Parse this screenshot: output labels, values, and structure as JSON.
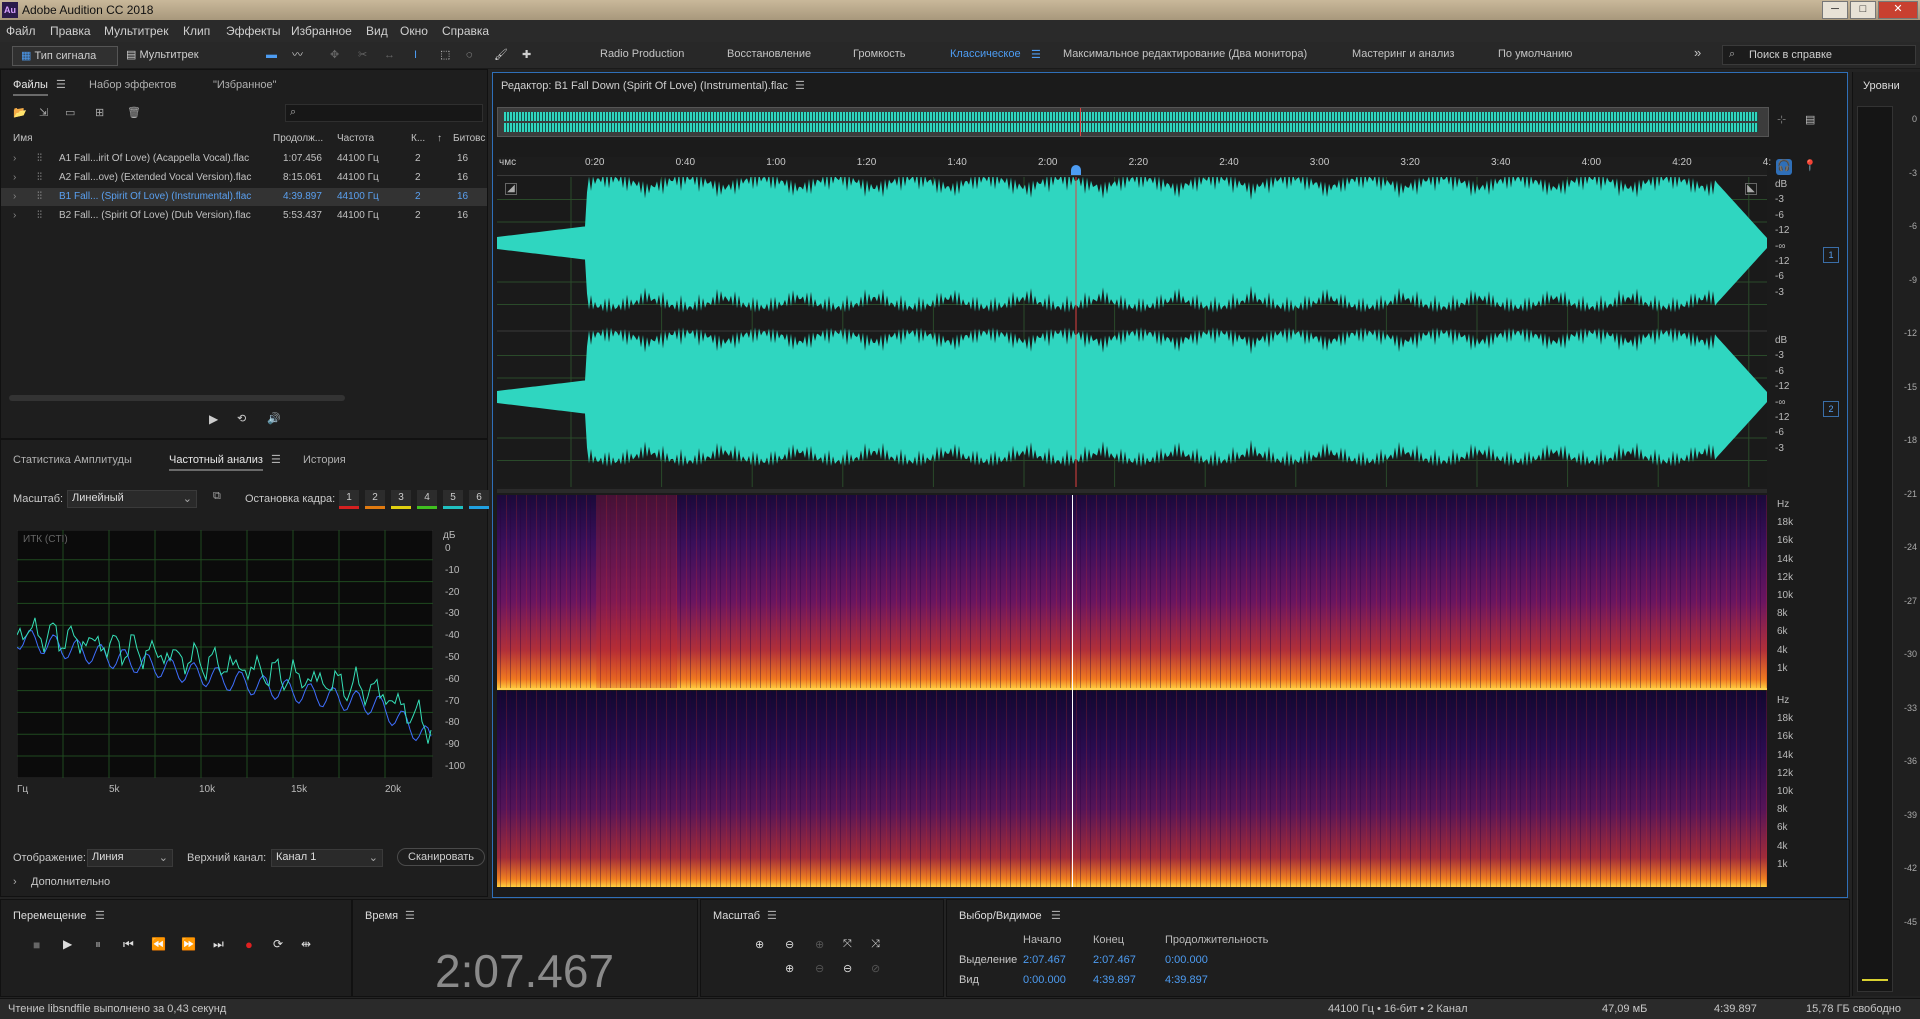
{
  "app": {
    "title": "Adobe Audition CC 2018",
    "icon_text": "Au"
  },
  "window_buttons": [
    "─",
    "□",
    "✕"
  ],
  "menu": [
    "Файл",
    "Правка",
    "Мультитрек",
    "Клип",
    "Эффекты",
    "Избранное",
    "Вид",
    "Окно",
    "Справка"
  ],
  "toolbar": {
    "waveform_label": "Тип сигнала",
    "multitrack_label": "Мультитрек",
    "workspaces": [
      "Radio Production",
      "Восстановление",
      "Громкость",
      "Классическое",
      "Максимальное редактирование (Два монитора)",
      "Мастеринг и анализ",
      "По умолчанию"
    ],
    "active_workspace": "Классическое",
    "search_placeholder": "Поиск в справке"
  },
  "files_panel": {
    "tabs": [
      "Файлы",
      "Набор эффектов",
      "\"Избранное\""
    ],
    "columns": [
      "Имя",
      "Продолж...",
      "Частота",
      "К...",
      "Битовс"
    ],
    "rows": [
      {
        "name": "A1 Fall...irit Of Love) (Acappella Vocal).flac",
        "duration": "1:07.456",
        "rate": "44100 Гц",
        "ch": "2",
        "bits": "16",
        "selected": false
      },
      {
        "name": "A2 Fall...ove) (Extended Vocal Version).flac",
        "duration": "8:15.061",
        "rate": "44100 Гц",
        "ch": "2",
        "bits": "16",
        "selected": false
      },
      {
        "name": "B1 Fall... (Spirit Of Love) (Instrumental).flac",
        "duration": "4:39.897",
        "rate": "44100 Гц",
        "ch": "2",
        "bits": "16",
        "selected": true
      },
      {
        "name": "B2 Fall... (Spirit Of Love) (Dub Version).flac",
        "duration": "5:53.437",
        "rate": "44100 Гц",
        "ch": "2",
        "bits": "16",
        "selected": false
      }
    ]
  },
  "analysis_panel": {
    "tabs": [
      "Статистика Амплитуды",
      "Частотный анализ",
      "История"
    ],
    "scale_label": "Масштаб:",
    "scale_value": "Линейный",
    "freeze_label": "Остановка кадра:",
    "freeze_buttons": [
      "1",
      "2",
      "3",
      "4",
      "5",
      "6"
    ],
    "freeze_colors": [
      "#d42020",
      "#e07a10",
      "#e0d010",
      "#40c020",
      "#20c0c0",
      "#20a0e0"
    ],
    "graph_label": "ИТК (CTI)",
    "db_unit": "дБ",
    "db_ticks": [
      "0",
      "-10",
      "-20",
      "-30",
      "-40",
      "-50",
      "-60",
      "-70",
      "-80",
      "-90",
      "-100"
    ],
    "hz_ticks": [
      "Гц",
      "5k",
      "10k",
      "15k",
      "20k"
    ],
    "display_label": "Отображение:",
    "display_value": "Линия",
    "channel_label": "Верхний канал:",
    "channel_value": "Канал 1",
    "scan_button": "Сканировать",
    "advanced_label": "Дополнительно"
  },
  "editor": {
    "title": "Редактор: B1 Fall Down (Spirit Of Love) (Instrumental).flac",
    "ruler_unit": "чмс",
    "ruler_ticks": [
      "0:20",
      "0:40",
      "1:00",
      "1:20",
      "1:40",
      "2:00",
      "2:20",
      "2:40",
      "3:00",
      "3:20",
      "3:40",
      "4:00",
      "4:20",
      "4:"
    ],
    "db_scale": [
      "dB",
      "-3",
      "-6",
      "-12",
      "-∞",
      "-12",
      "-6",
      "-3"
    ],
    "channel_badges": [
      "1",
      "2"
    ],
    "hz_scale": [
      "Hz",
      "18k",
      "16k",
      "14k",
      "12k",
      "10k",
      "8k",
      "6k",
      "4k",
      "1k"
    ]
  },
  "levels_panel": {
    "title": "Уровни",
    "ticks": [
      "0",
      "-3",
      "-6",
      "-9",
      "-12",
      "-15",
      "-18",
      "-21",
      "-24",
      "-27",
      "-30",
      "-33",
      "-36",
      "-39",
      "-42",
      "-45"
    ]
  },
  "transport": {
    "title": "Перемещение"
  },
  "time": {
    "title": "Время",
    "value": "2:07.467"
  },
  "zoom": {
    "title": "Масштаб"
  },
  "selection": {
    "title": "Выбор/Видимое",
    "headers": [
      "Начало",
      "Конец",
      "Продолжительность"
    ],
    "rows": [
      {
        "label": "Выделение",
        "start": "2:07.467",
        "end": "2:07.467",
        "duration": "0:00.000"
      },
      {
        "label": "Вид",
        "start": "0:00.000",
        "end": "4:39.897",
        "duration": "4:39.897"
      }
    ]
  },
  "status": {
    "message": "Чтение libsndfile выполнено за 0,43 секунд",
    "format": "44100 Гц • 16-бит • 2 Канал",
    "size": "47,09 мБ",
    "duration": "4:39.897",
    "free": "15,78 ГБ свободно"
  },
  "colors": {
    "accent": "#4d9cf2",
    "waveform": "#2fd6c0",
    "playhead": "#e04040"
  }
}
